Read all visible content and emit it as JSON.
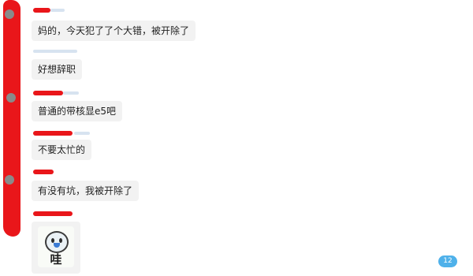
{
  "messages": [
    {
      "text": "妈的，今天犯了了个大错，被开除了"
    },
    {
      "text": "好想辞职"
    },
    {
      "text": "普通的带核显e5吧"
    },
    {
      "text": "不要太忙的"
    },
    {
      "text": "有没有坑，我被开除了"
    }
  ],
  "sticker": {
    "text": "哇"
  },
  "unread_badge": {
    "count": "12"
  },
  "colors": {
    "bubble": "#f2f2f2",
    "redaction": "#e9161a",
    "badge": "#4fb1ea"
  }
}
